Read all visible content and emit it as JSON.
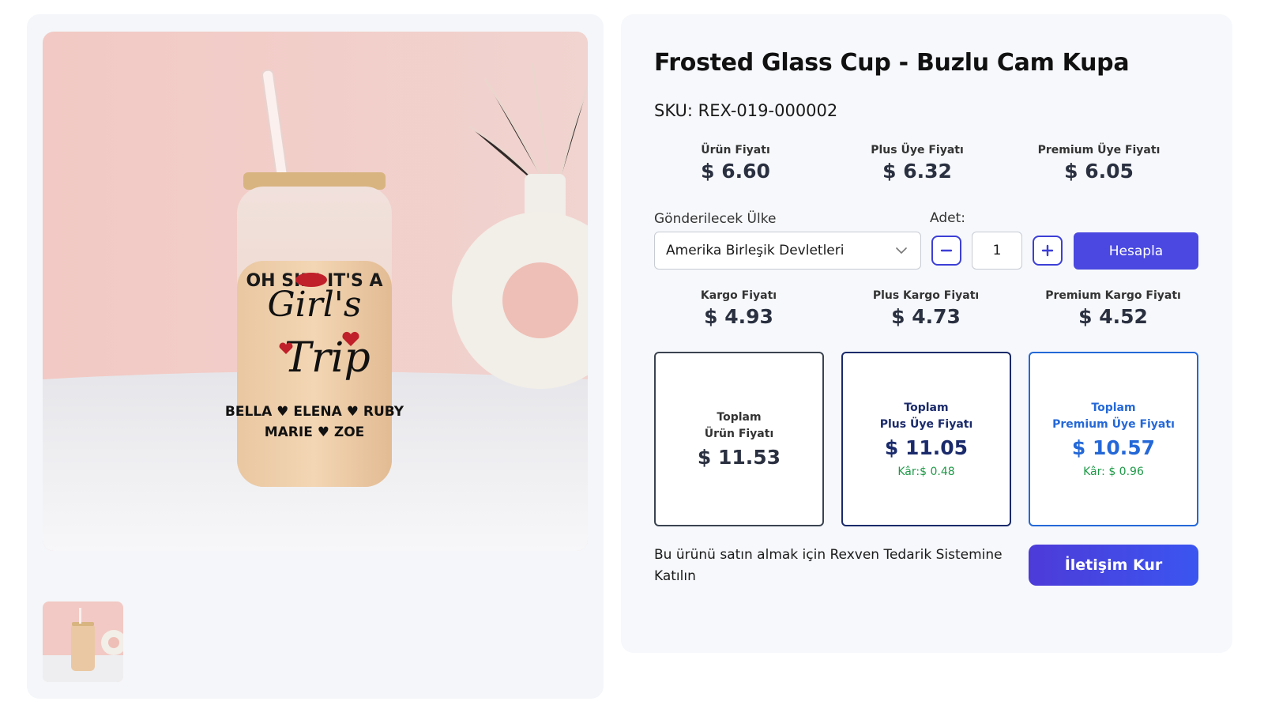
{
  "product": {
    "title": "Frosted Glass Cup - Buzlu Cam Kupa",
    "sku": "SKU: REX-019-000002",
    "image_alt": "Frosted glass cup with 'Oh Sip! It's a Girl's Trip' print"
  },
  "mug_print": {
    "line1": "OH SIP! IT'S A",
    "line2": "Girl's",
    "line3": "Trip",
    "names1": "BELLA ♥ ELENA ♥ RUBY",
    "names2": "MARIE ♥ ZOE"
  },
  "prices": [
    {
      "label": "Ürün Fiyatı",
      "value": "$ 6.60"
    },
    {
      "label": "Plus Üye Fiyatı",
      "value": "$ 6.32"
    },
    {
      "label": "Premium Üye Fiyatı",
      "value": "$ 6.05"
    }
  ],
  "shipping_form": {
    "country_label": "Gönderilecek Ülke",
    "country_value": "Amerika Birleşik Devletleri",
    "qty_label": "Adet:",
    "qty_value": "1",
    "calculate_label": "Hesapla"
  },
  "shipping_prices": [
    {
      "label": "Kargo Fiyatı",
      "value": "$ 4.93"
    },
    {
      "label": "Plus Kargo Fiyatı",
      "value": "$ 4.73"
    },
    {
      "label": "Premium Kargo Fiyatı",
      "value": "$ 4.52"
    }
  ],
  "totals": [
    {
      "label1": "Toplam",
      "label2": "Ürün Fiyatı",
      "value": "$ 11.53",
      "profit": ""
    },
    {
      "label1": "Toplam",
      "label2": "Plus Üye Fiyatı",
      "value": "$ 11.05",
      "profit": "Kâr:$ 0.48"
    },
    {
      "label1": "Toplam",
      "label2": "Premium Üye Fiyatı",
      "value": "$ 10.57",
      "profit": "Kâr: $ 0.96"
    }
  ],
  "cta": {
    "text": "Bu ürünü satın almak için Rexven Tedarik Sistemine Katılın",
    "button_label": "İletişim Kur"
  },
  "colors": {
    "primary": "#4a48e0",
    "plus_text": "#1a2a6b",
    "premium_text": "#2468d8",
    "profit": "#1f9a48"
  }
}
